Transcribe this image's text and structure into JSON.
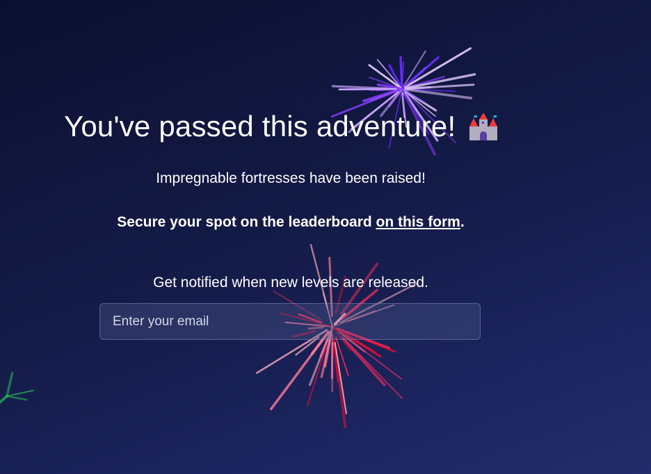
{
  "title": "You've passed this adventure!",
  "title_icon": "castle-icon",
  "subtitle": "Impregnable fortresses have been raised!",
  "leaderboard": {
    "text": "Secure your spot on the leaderboard ",
    "link": "on this form",
    "suffix": "."
  },
  "notify_text": "Get notified when new levels are released.",
  "email_input": {
    "placeholder": "Enter your email",
    "value": ""
  },
  "colors": {
    "background_top": "#0c1030",
    "background_bottom": "#222d6a",
    "firework_purple": "#8a3cff",
    "firework_red": "#ff2a5a"
  }
}
